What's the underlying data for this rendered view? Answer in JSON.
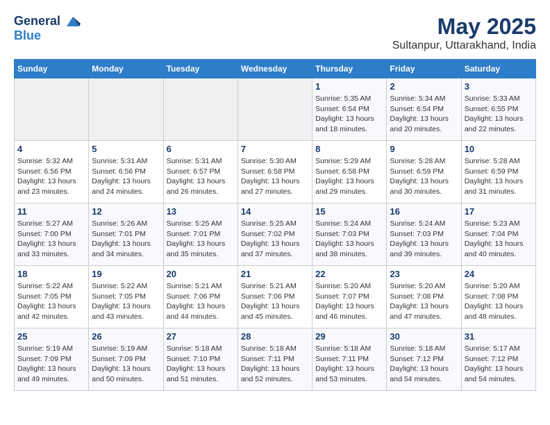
{
  "header": {
    "logo_line1": "General",
    "logo_line2": "Blue",
    "month": "May 2025",
    "location": "Sultanpur, Uttarakhand, India"
  },
  "weekdays": [
    "Sunday",
    "Monday",
    "Tuesday",
    "Wednesday",
    "Thursday",
    "Friday",
    "Saturday"
  ],
  "weeks": [
    [
      {
        "day": "",
        "info": ""
      },
      {
        "day": "",
        "info": ""
      },
      {
        "day": "",
        "info": ""
      },
      {
        "day": "",
        "info": ""
      },
      {
        "day": "1",
        "info": "Sunrise: 5:35 AM\nSunset: 6:54 PM\nDaylight: 13 hours\nand 18 minutes."
      },
      {
        "day": "2",
        "info": "Sunrise: 5:34 AM\nSunset: 6:54 PM\nDaylight: 13 hours\nand 20 minutes."
      },
      {
        "day": "3",
        "info": "Sunrise: 5:33 AM\nSunset: 6:55 PM\nDaylight: 13 hours\nand 22 minutes."
      }
    ],
    [
      {
        "day": "4",
        "info": "Sunrise: 5:32 AM\nSunset: 6:56 PM\nDaylight: 13 hours\nand 23 minutes."
      },
      {
        "day": "5",
        "info": "Sunrise: 5:31 AM\nSunset: 6:56 PM\nDaylight: 13 hours\nand 24 minutes."
      },
      {
        "day": "6",
        "info": "Sunrise: 5:31 AM\nSunset: 6:57 PM\nDaylight: 13 hours\nand 26 minutes."
      },
      {
        "day": "7",
        "info": "Sunrise: 5:30 AM\nSunset: 6:58 PM\nDaylight: 13 hours\nand 27 minutes."
      },
      {
        "day": "8",
        "info": "Sunrise: 5:29 AM\nSunset: 6:58 PM\nDaylight: 13 hours\nand 29 minutes."
      },
      {
        "day": "9",
        "info": "Sunrise: 5:28 AM\nSunset: 6:59 PM\nDaylight: 13 hours\nand 30 minutes."
      },
      {
        "day": "10",
        "info": "Sunrise: 5:28 AM\nSunset: 6:59 PM\nDaylight: 13 hours\nand 31 minutes."
      }
    ],
    [
      {
        "day": "11",
        "info": "Sunrise: 5:27 AM\nSunset: 7:00 PM\nDaylight: 13 hours\nand 33 minutes."
      },
      {
        "day": "12",
        "info": "Sunrise: 5:26 AM\nSunset: 7:01 PM\nDaylight: 13 hours\nand 34 minutes."
      },
      {
        "day": "13",
        "info": "Sunrise: 5:25 AM\nSunset: 7:01 PM\nDaylight: 13 hours\nand 35 minutes."
      },
      {
        "day": "14",
        "info": "Sunrise: 5:25 AM\nSunset: 7:02 PM\nDaylight: 13 hours\nand 37 minutes."
      },
      {
        "day": "15",
        "info": "Sunrise: 5:24 AM\nSunset: 7:03 PM\nDaylight: 13 hours\nand 38 minutes."
      },
      {
        "day": "16",
        "info": "Sunrise: 5:24 AM\nSunset: 7:03 PM\nDaylight: 13 hours\nand 39 minutes."
      },
      {
        "day": "17",
        "info": "Sunrise: 5:23 AM\nSunset: 7:04 PM\nDaylight: 13 hours\nand 40 minutes."
      }
    ],
    [
      {
        "day": "18",
        "info": "Sunrise: 5:22 AM\nSunset: 7:05 PM\nDaylight: 13 hours\nand 42 minutes."
      },
      {
        "day": "19",
        "info": "Sunrise: 5:22 AM\nSunset: 7:05 PM\nDaylight: 13 hours\nand 43 minutes."
      },
      {
        "day": "20",
        "info": "Sunrise: 5:21 AM\nSunset: 7:06 PM\nDaylight: 13 hours\nand 44 minutes."
      },
      {
        "day": "21",
        "info": "Sunrise: 5:21 AM\nSunset: 7:06 PM\nDaylight: 13 hours\nand 45 minutes."
      },
      {
        "day": "22",
        "info": "Sunrise: 5:20 AM\nSunset: 7:07 PM\nDaylight: 13 hours\nand 46 minutes."
      },
      {
        "day": "23",
        "info": "Sunrise: 5:20 AM\nSunset: 7:08 PM\nDaylight: 13 hours\nand 47 minutes."
      },
      {
        "day": "24",
        "info": "Sunrise: 5:20 AM\nSunset: 7:08 PM\nDaylight: 13 hours\nand 48 minutes."
      }
    ],
    [
      {
        "day": "25",
        "info": "Sunrise: 5:19 AM\nSunset: 7:09 PM\nDaylight: 13 hours\nand 49 minutes."
      },
      {
        "day": "26",
        "info": "Sunrise: 5:19 AM\nSunset: 7:09 PM\nDaylight: 13 hours\nand 50 minutes."
      },
      {
        "day": "27",
        "info": "Sunrise: 5:18 AM\nSunset: 7:10 PM\nDaylight: 13 hours\nand 51 minutes."
      },
      {
        "day": "28",
        "info": "Sunrise: 5:18 AM\nSunset: 7:11 PM\nDaylight: 13 hours\nand 52 minutes."
      },
      {
        "day": "29",
        "info": "Sunrise: 5:18 AM\nSunset: 7:11 PM\nDaylight: 13 hours\nand 53 minutes."
      },
      {
        "day": "30",
        "info": "Sunrise: 5:18 AM\nSunset: 7:12 PM\nDaylight: 13 hours\nand 54 minutes."
      },
      {
        "day": "31",
        "info": "Sunrise: 5:17 AM\nSunset: 7:12 PM\nDaylight: 13 hours\nand 54 minutes."
      }
    ]
  ]
}
